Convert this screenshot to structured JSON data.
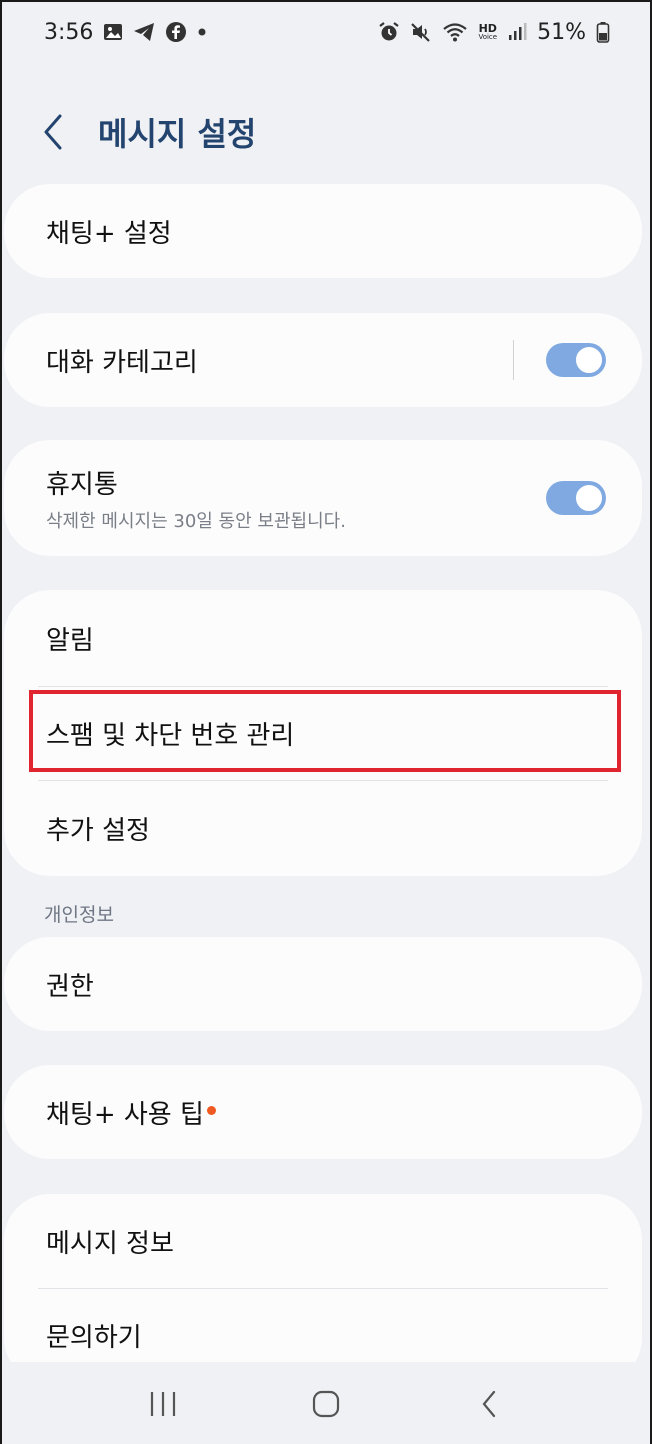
{
  "status_bar": {
    "time": "3:56",
    "battery": "51%",
    "hd_label": "HD",
    "voice_label": "Voice",
    "left_icons": [
      "gallery-icon",
      "telegram-icon",
      "facebook-icon",
      "dot-icon"
    ],
    "right_icons": [
      "alarm-icon",
      "mute-icon",
      "wifi-icon",
      "hd-voice-icon",
      "signal-icon",
      "battery-icon"
    ]
  },
  "header": {
    "title": "메시지 설정",
    "back_icon": "chevron-left-icon"
  },
  "items": {
    "chat_plus_settings": "채팅+ 설정",
    "conversation_categories": "대화 카테고리",
    "trash": "휴지통",
    "trash_desc": "삭제한 메시지는 30일 동안 보관됩니다.",
    "notifications": "알림",
    "spam_block": "스팸 및 차단 번호 관리",
    "more_settings": "추가 설정",
    "permissions": "권한",
    "chat_plus_tips": "채팅+ 사용 팁",
    "message_info": "메시지 정보",
    "contact_us": "문의하기"
  },
  "toggles": {
    "conversation_categories": true,
    "trash": true
  },
  "sections": {
    "privacy": "개인정보"
  },
  "colors": {
    "accent_toggle": "#7fa9e0",
    "title": "#23446e",
    "highlight_box": "#e02531",
    "new_dot": "#ef5a23",
    "background": "#f0f1f5"
  },
  "navbar": {
    "icons": [
      "recents-icon",
      "home-icon",
      "back-icon"
    ]
  }
}
